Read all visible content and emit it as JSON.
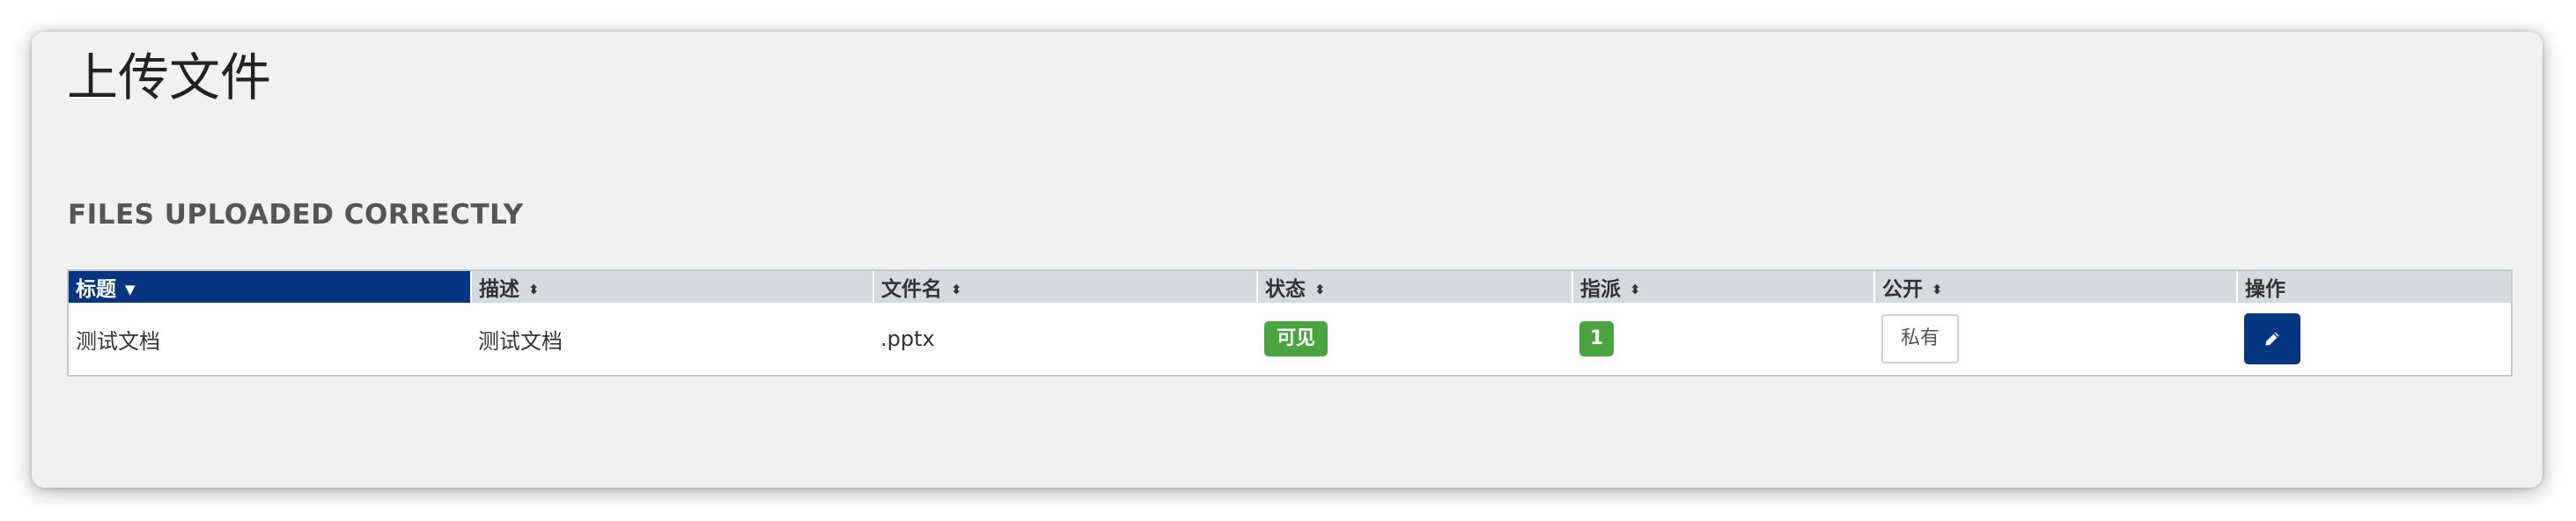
{
  "page": {
    "title": "上传文件",
    "section_title": "FILES UPLOADED CORRECTLY"
  },
  "table": {
    "columns": [
      {
        "label": "标题",
        "sort": "caret-down-icon",
        "sorted": true
      },
      {
        "label": "描述",
        "sort": "sort-icon",
        "sorted": false
      },
      {
        "label": "文件名",
        "sort": "sort-icon",
        "sorted": false
      },
      {
        "label": "状态",
        "sort": "sort-icon",
        "sorted": false
      },
      {
        "label": "指派",
        "sort": "sort-icon",
        "sorted": false
      },
      {
        "label": "公开",
        "sort": "sort-icon",
        "sorted": false
      },
      {
        "label": "操作",
        "sort": null,
        "sorted": false
      }
    ],
    "rows": [
      {
        "title": "测试文档",
        "description": "测试文档",
        "filename": ".pptx",
        "status": "可见",
        "assigned": "1",
        "public": "私有",
        "action_icon": "pencil-icon"
      }
    ]
  },
  "colors": {
    "header_bg": "#d6dadf",
    "sorted_header_bg": "#063680",
    "badge_green": "#4aa540",
    "edit_button_bg": "#063680",
    "panel_bg": "#f1f1f1"
  }
}
